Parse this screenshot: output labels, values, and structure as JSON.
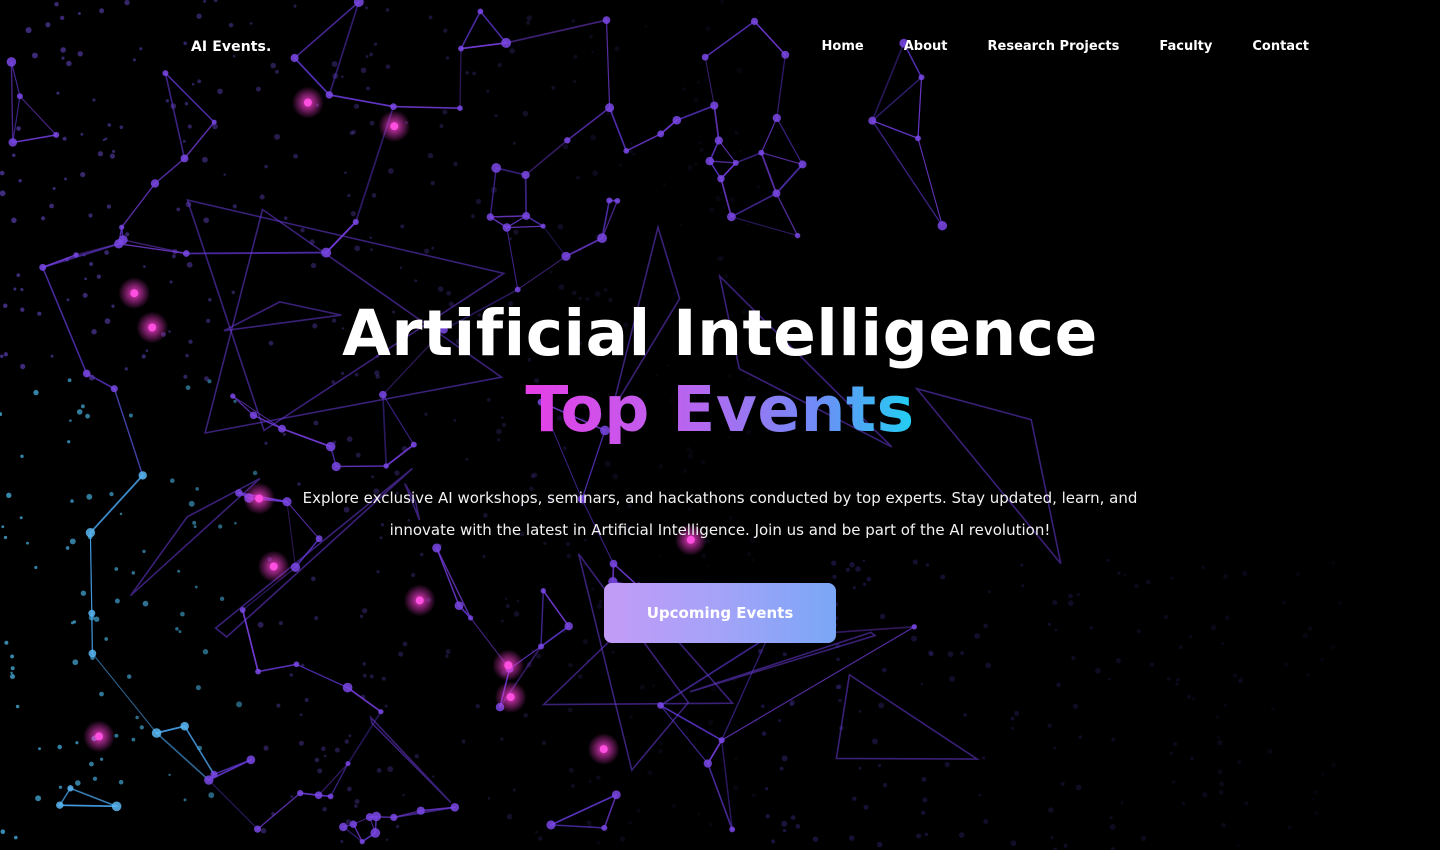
{
  "header": {
    "logo": "AI Events.",
    "nav": [
      "Home",
      "About",
      "Research Projects",
      "Faculty",
      "Contact"
    ]
  },
  "hero": {
    "title": "Artificial Intelligence",
    "subtitle": "Top Events",
    "description": "Explore exclusive AI workshops, seminars, and hackathons conducted by top experts. Stay updated, learn, and innovate with the latest in Artificial Intelligence. Join us and be part of the AI revolution!",
    "cta": "Upcoming Events"
  },
  "colors": {
    "background": "#000000",
    "gradient_pink": "#e53fe6",
    "gradient_purple": "#b468f0",
    "gradient_blue": "#6f8cf7",
    "gradient_cyan": "#20d0f2",
    "button_start": "#c39bf7",
    "button_end": "#7aa6f6",
    "network_purple": "#7b3fe4",
    "network_cyan": "#4fc3f7"
  },
  "decoration": {
    "background_graphic": "network-mesh"
  }
}
